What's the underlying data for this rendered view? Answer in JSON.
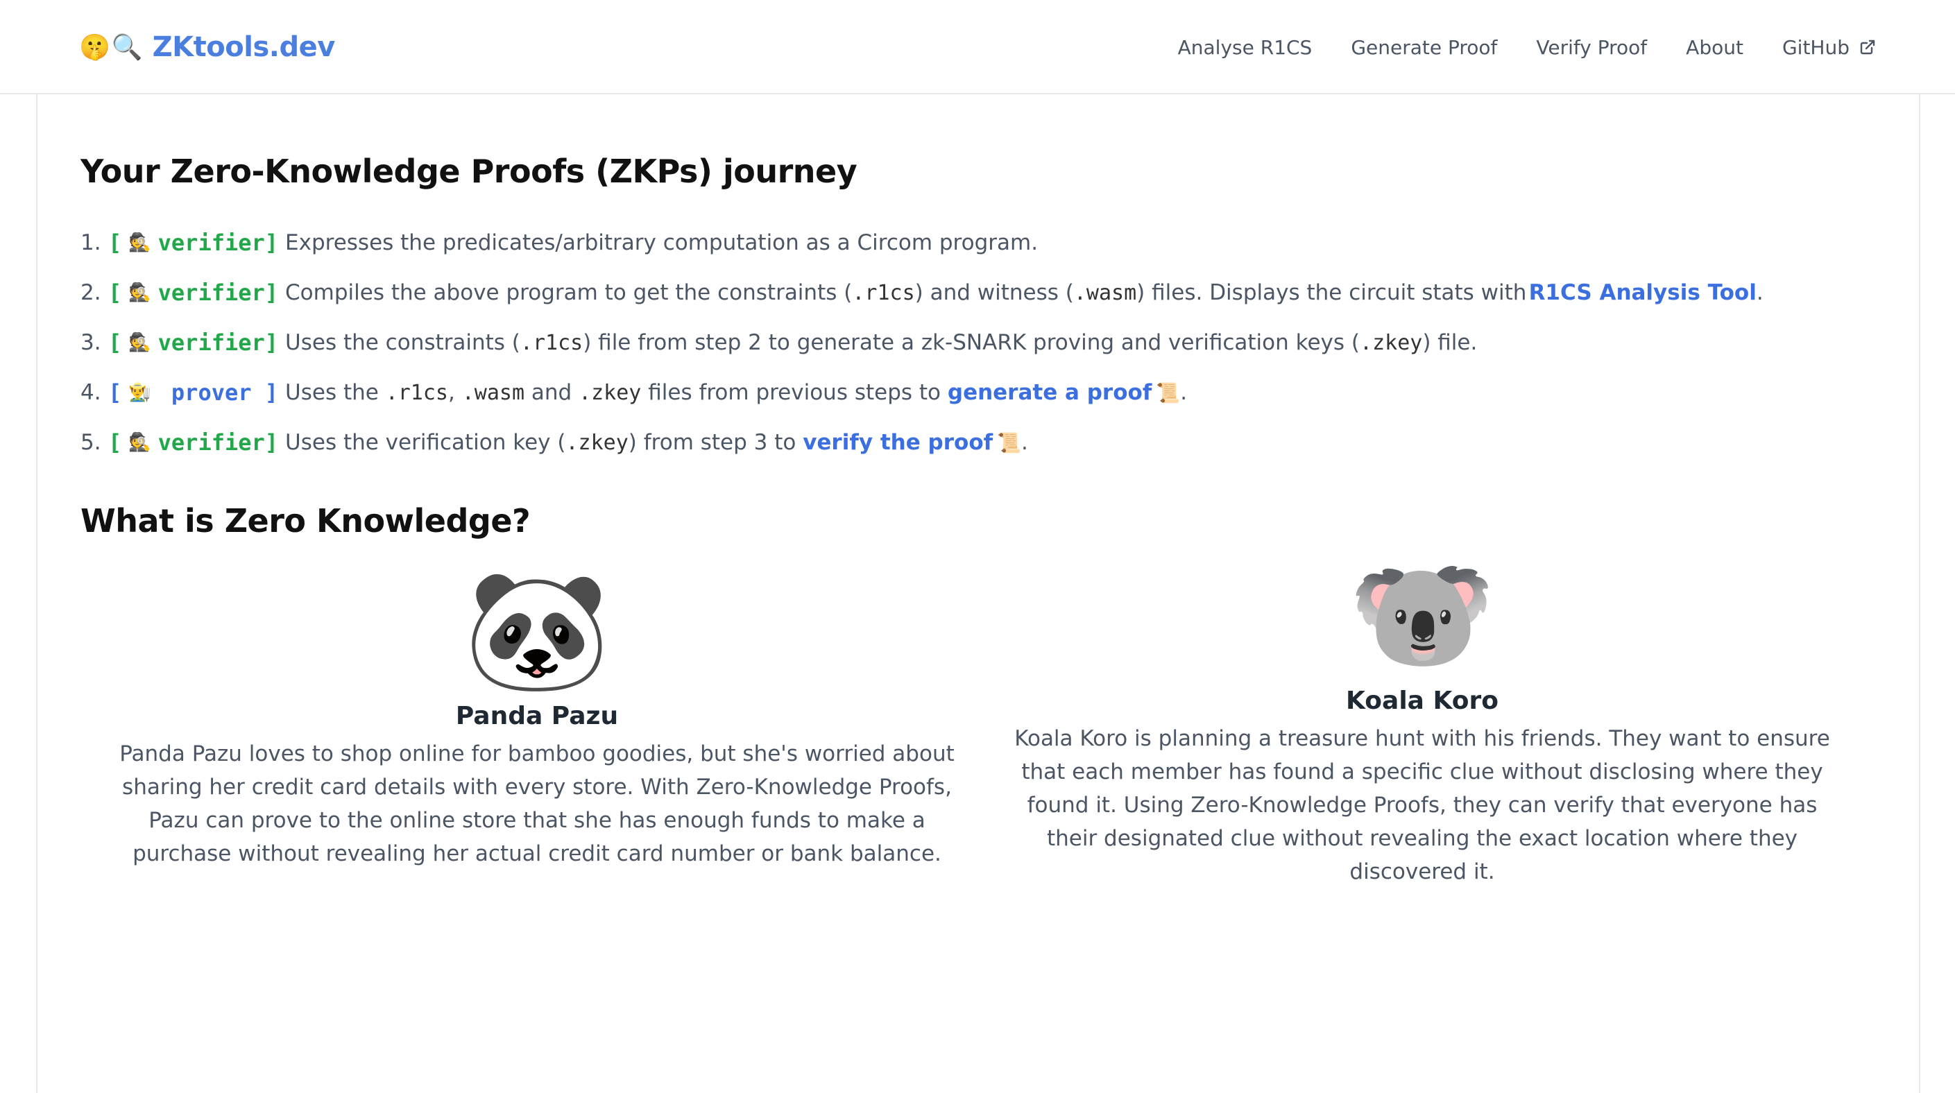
{
  "header": {
    "brand_emoji_1": "🤫",
    "brand_emoji_2": "🔍",
    "brand_text": "ZKtools.dev",
    "nav": [
      {
        "label": "Analyse R1CS"
      },
      {
        "label": "Generate Proof"
      },
      {
        "label": "Verify Proof"
      },
      {
        "label": "About"
      },
      {
        "label": "GitHub",
        "icon": "external-link-icon"
      }
    ]
  },
  "journey": {
    "title": "Your Zero-Knowledge Proofs (ZKPs) journey",
    "steps": [
      {
        "num": "1.",
        "role": "verifier",
        "emoji": "🕵️",
        "parts": {
          "a": "Expresses the predicates/arbitrary computation as a Circom program."
        }
      },
      {
        "num": "2.",
        "role": "verifier",
        "emoji": "🕵️",
        "parts": {
          "a": "Compiles the above program to get the constraints (",
          "code1": ".r1cs",
          "b": ") and witness (",
          "code2": ".wasm",
          "c": ") files. Displays the circuit stats with ",
          "link": "R1CS Analysis Tool",
          "d": "."
        }
      },
      {
        "num": "3.",
        "role": "verifier",
        "emoji": "🕵️",
        "parts": {
          "a": "Uses the constraints (",
          "code1": ".r1cs",
          "b": ") file from step 2 to generate a zk-SNARK proving and verification keys (",
          "code2": ".zkey",
          "c": ") file."
        }
      },
      {
        "num": "4.",
        "role": " prover ",
        "emoji": "👨‍🌾",
        "parts": {
          "a": "Uses the ",
          "code1": ".r1cs",
          "b": ", ",
          "code2": ".wasm",
          "c": " and ",
          "code3": ".zkey",
          "d": " files from previous steps to ",
          "link": "generate a proof",
          "scroll": "📜",
          "e": "."
        }
      },
      {
        "num": "5.",
        "role": "verifier",
        "emoji": "🕵️",
        "parts": {
          "a": "Uses the verification key (",
          "code1": ".zkey",
          "b": ") from step 3 to ",
          "link": "verify the proof",
          "scroll": "📜",
          "c": "."
        }
      }
    ]
  },
  "what_is": {
    "title": "What is Zero Knowledge?",
    "cards": [
      {
        "avatar": "🐼",
        "name": "Panda Pazu",
        "lines": [
          "Panda Pazu loves to shop online for bamboo goodies, but she's worried about",
          "sharing her credit card details with every store. With Zero-Knowledge Proofs,",
          "Pazu can prove to the online store that she has enough funds to make a",
          "purchase without revealing her actual credit card number or bank balance."
        ]
      },
      {
        "avatar": "🐨",
        "name": "Koala Koro",
        "lines": [
          "Koala Koro is planning a treasure hunt with his friends. They want to ensure",
          "that each member has found a specific clue without disclosing where they",
          "found it. Using Zero-Knowledge Proofs, they can verify that everyone has",
          "their designated clue without revealing the exact location where they",
          "discovered it."
        ]
      }
    ]
  },
  "colors": {
    "brand": "#4a7fe0",
    "verifier": "#22a84a",
    "prover": "#3b6fe0",
    "link": "#3b6fe0"
  }
}
